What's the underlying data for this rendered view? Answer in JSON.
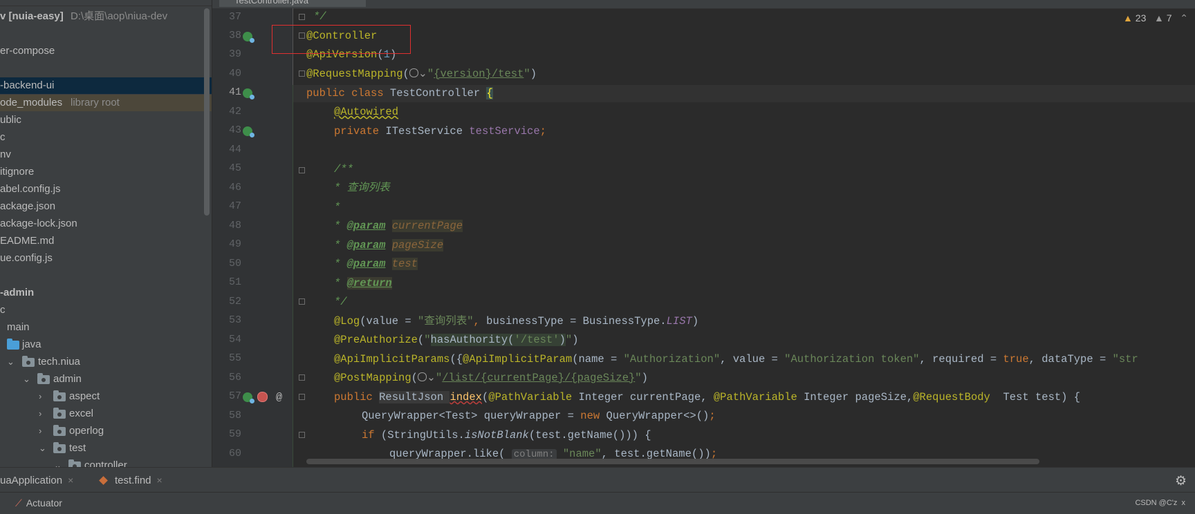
{
  "project": {
    "root_name": "v [nuia-easy]",
    "root_path": "D:\\桌面\\aop\\niua-dev",
    "items": [
      {
        "label": "er-compose"
      },
      {
        "label": "-backend-ui"
      },
      {
        "label": "ode_modules",
        "suffix": "library root"
      },
      {
        "label": "ublic"
      },
      {
        "label": "c"
      },
      {
        "label": "nv"
      },
      {
        "label": "itignore"
      },
      {
        "label": "abel.config.js"
      },
      {
        "label": "ackage.json"
      },
      {
        "label": "ackage-lock.json"
      },
      {
        "label": "EADME.md"
      },
      {
        "label": "ue.config.js"
      },
      {
        "label": "-admin"
      },
      {
        "label": "c"
      },
      {
        "label": "main"
      },
      {
        "label": "java"
      },
      {
        "label": "tech.niua"
      },
      {
        "label": "admin"
      },
      {
        "label": "aspect"
      },
      {
        "label": "excel"
      },
      {
        "label": "operlog"
      },
      {
        "label": "test"
      },
      {
        "label": "controller"
      }
    ]
  },
  "editor": {
    "tab_label": "TestController.java",
    "inspections": {
      "warnings": "23",
      "weak_warnings": "7"
    },
    "line_numbers": [
      "37",
      "38",
      "39",
      "40",
      "41",
      "42",
      "43",
      "44",
      "45",
      "46",
      "47",
      "48",
      "49",
      "50",
      "51",
      "52",
      "53",
      "54",
      "55",
      "56",
      "57",
      "58",
      "59",
      "60"
    ],
    "current_line": "41",
    "gutter_at": "@",
    "code": {
      "l37": "*/",
      "l38_anno": "@Controller",
      "l39_anno": "@ApiVersion",
      "l39_open": "(",
      "l39_num": "1",
      "l39_close": ")",
      "l40_anno": "@RequestMapping",
      "l40_open": "(",
      "l40_str1": "\"",
      "l40_link": "{version}/test",
      "l40_str2": "\"",
      "l40_close": ")",
      "l41_kw": "public class ",
      "l41_name": "TestController ",
      "l41_brace": "{",
      "l42_anno": "@Autowired",
      "l43_kw": "private ",
      "l43_type": "ITestService ",
      "l43_field": "testService",
      "l43_semi": ";",
      "l45": "/**",
      "l46": "* 查询列表",
      "l47": "*",
      "l48_star": "* ",
      "l48_tag": "@param",
      "l48_name": "currentPage",
      "l49_star": "* ",
      "l49_tag": "@param",
      "l49_name": "pageSize",
      "l50_star": "* ",
      "l50_tag": "@param",
      "l50_name": "test",
      "l51_star": "* ",
      "l51_tag": "@return",
      "l52": "*/",
      "l53_anno": "@Log",
      "l53_a": "(value = ",
      "l53_str": "\"查询列表\"",
      "l53_comma": ", ",
      "l53_b": "businessType = BusinessType.",
      "l53_const": "LIST",
      "l53_close": ")",
      "l54_anno": "@PreAuthorize",
      "l54_open": "(",
      "l54_s1": "\"",
      "l54_inner": "hasAuthority(",
      "l54_s2": "'/test'",
      "l54_inner2": ")",
      "l54_s3": "\"",
      "l54_close": ")",
      "l55_anno": "@ApiImplicitParams",
      "l55_a": "({",
      "l55_anno2": "@ApiImplicitParam",
      "l55_b": "(name = ",
      "l55_s1": "\"Authorization\"",
      "l55_c": ", value = ",
      "l55_s2": "\"Authorization token\"",
      "l55_d": ", required = ",
      "l55_kw": "true",
      "l55_e": ", dataType = ",
      "l55_s3": "\"str",
      "l56_anno": "@PostMapping",
      "l56_open": "(",
      "l56_s1": "\"",
      "l56_link": "/list/{currentPage}/{pageSize}",
      "l56_s2": "\"",
      "l56_close": ")",
      "l57_kw": "public ",
      "l57_type": "ResultJson ",
      "l57_method": "index",
      "l57_a": "(",
      "l57_anno1": "@PathVariable ",
      "l57_b": "Integer currentPage, ",
      "l57_anno2": "@PathVariable ",
      "l57_c": "Integer pageSize,",
      "l57_anno3": "@RequestBody  ",
      "l57_d": "Test test) {",
      "l58_a": "QueryWrapper<Test> queryWrapper = ",
      "l58_kw": "new ",
      "l58_b": "QueryWrapper<>()",
      "l58_semi": ";",
      "l59_kw": "if ",
      "l59_a": "(StringUtils.",
      "l59_m": "isNotBlank",
      "l59_b": "(test.getName())) {",
      "l60_a": "queryWrapper.like( ",
      "l60_hint": "column:",
      "l60_str": " \"name\"",
      "l60_b": ", test.getName())",
      "l60_semi": ";"
    }
  },
  "bottom": {
    "run_tabs": [
      {
        "label": "uaApplication",
        "close": "×"
      },
      {
        "label": "test.find",
        "close": "×"
      }
    ],
    "status_item": "Actuator",
    "watermark": "CSDN @C'z",
    "watermark_close": "x"
  },
  "icons": {
    "gear": "gear-icon",
    "warning": "warning-icon",
    "chevron": "chevron-up-icon",
    "actuator": "actuator-icon"
  },
  "colors": {
    "keyword": "#cc7832",
    "annotation": "#bbb529",
    "string": "#6a8759",
    "doc_comment": "#629755",
    "field": "#9876aa",
    "number": "#6897bb",
    "highlight_box": "#e03030",
    "warning": "#e0a53c"
  }
}
